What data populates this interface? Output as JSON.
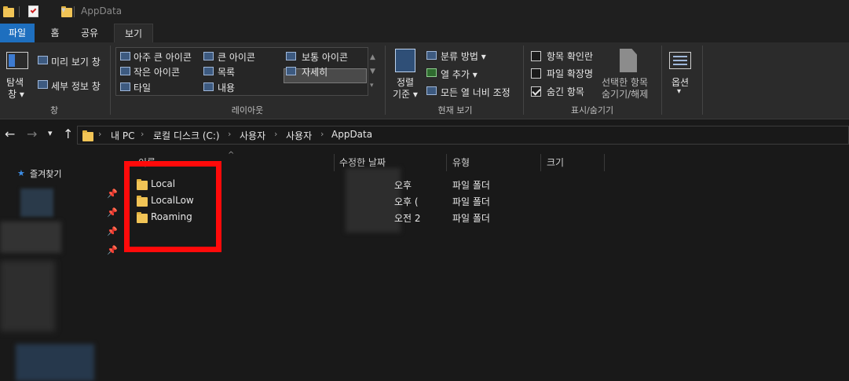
{
  "window": {
    "title": "AppData"
  },
  "tabs": [
    {
      "label": "파일"
    },
    {
      "label": "홈"
    },
    {
      "label": "공유"
    },
    {
      "label": "보기"
    }
  ],
  "ribbon": {
    "pane": {
      "nav_pane_label_1": "탐색",
      "nav_pane_label_2": "창",
      "preview": "미리 보기 창",
      "details": "세부 정보 창",
      "group": "창"
    },
    "layout": {
      "items": [
        "아주 큰 아이콘",
        "큰 아이콘",
        "보통 아이콘",
        "작은 아이콘",
        "목록",
        "자세히",
        "타일",
        "내용"
      ],
      "selected": "자세히",
      "group": "레이아웃"
    },
    "current_view": {
      "sort_1": "정렬",
      "sort_2": "기준",
      "group_by": "분류 방법",
      "add_columns": "열 추가",
      "size_all": "모든 열 너비 조정",
      "group": "현재 보기"
    },
    "show_hide": {
      "item_checkboxes": "항목 확인란",
      "file_extensions": "파일 확장명",
      "hidden_items": "숨긴 항목",
      "hide_selected_1": "선택한 항목",
      "hide_selected_2": "숨기기/해제",
      "group": "표시/숨기기"
    },
    "options": {
      "label": "옵션"
    }
  },
  "address": {
    "crumbs": [
      "내 PC",
      "로컬 디스크 (C:)",
      "사용자",
      "사용자",
      "AppData"
    ]
  },
  "nav_pane": {
    "quick_access": "즐겨찾기",
    "fragments": [
      "",
      "",
      ""
    ]
  },
  "columns": {
    "name": "이름",
    "modified": "수정한 날짜",
    "type": "유형",
    "size": "크기"
  },
  "files": [
    {
      "name": "Local",
      "date": "오후",
      "type": "파일 폴더"
    },
    {
      "name": "LocalLow",
      "date": "오후 (",
      "type": "파일 폴더"
    },
    {
      "name": "Roaming",
      "date": "오전 2",
      "type": "파일 폴더"
    }
  ],
  "colors": {
    "accent": "#1e6fbf",
    "highlight": "#ff0a0a",
    "folder": "#f1c456"
  }
}
